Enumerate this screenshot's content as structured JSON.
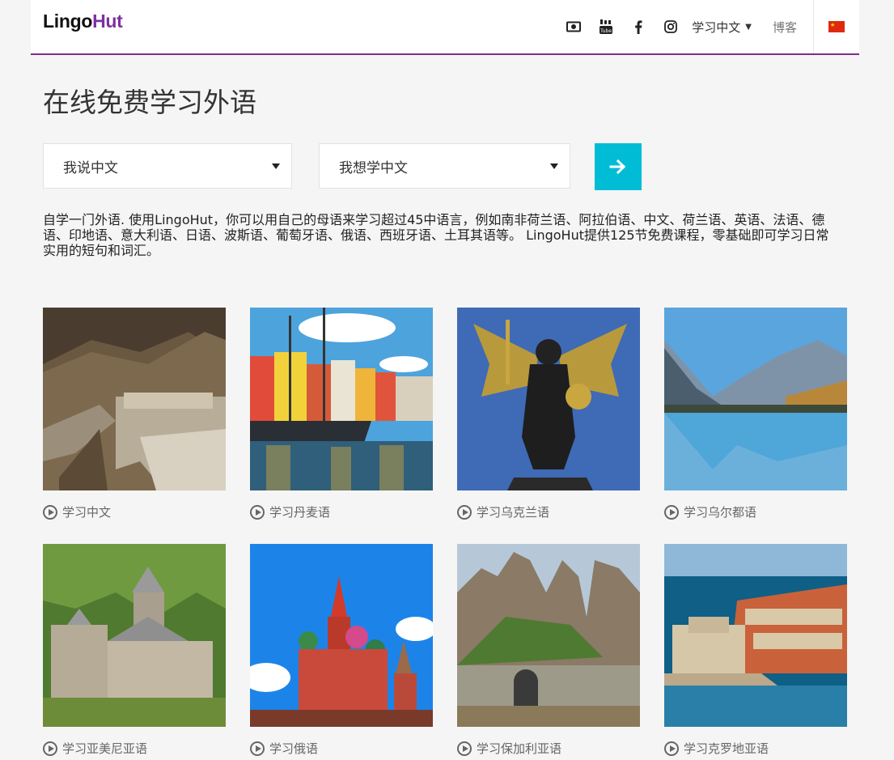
{
  "header": {
    "logo_part1": "Lingo",
    "logo_part2": "Hut",
    "icons": [
      "money-icon",
      "youtube-icon",
      "facebook-icon",
      "instagram-icon"
    ],
    "language_menu": "学习中文",
    "blog": "博客",
    "flag": "china-flag-icon"
  },
  "title": "在线免费学习外语",
  "form": {
    "native_select": "我说中文",
    "target_select": "我想学中文",
    "go_icon": "arrow-right-icon"
  },
  "intro": "自学一门外语. 使用LingoHut，你可以用自己的母语来学习超过45中语言，例如南非荷兰语、阿拉伯语、中文、荷兰语、英语、法语、德语、印地语、意大利语、日语、波斯语、葡萄牙语、俄语、西班牙语、土耳其语等。 LingoHut提供125节免费课程，零基础即可学习日常实用的短句和词汇。",
  "cards": [
    {
      "label": "学习中文",
      "image": "great-wall"
    },
    {
      "label": "学习丹麦语",
      "image": "nyhavn-harbor"
    },
    {
      "label": "学习乌克兰语",
      "image": "archangel-statue"
    },
    {
      "label": "学习乌尔都语",
      "image": "mountain-lake"
    },
    {
      "label": "学习亚美尼亚语",
      "image": "stone-monastery"
    },
    {
      "label": "学习俄语",
      "image": "st-basils-cathedral"
    },
    {
      "label": "学习保加利亚语",
      "image": "rock-fortress"
    },
    {
      "label": "学习克罗地亚语",
      "image": "dubrovnik-coast"
    }
  ],
  "colors": {
    "accent": "#7b2d8e",
    "button": "#00bcd4"
  }
}
